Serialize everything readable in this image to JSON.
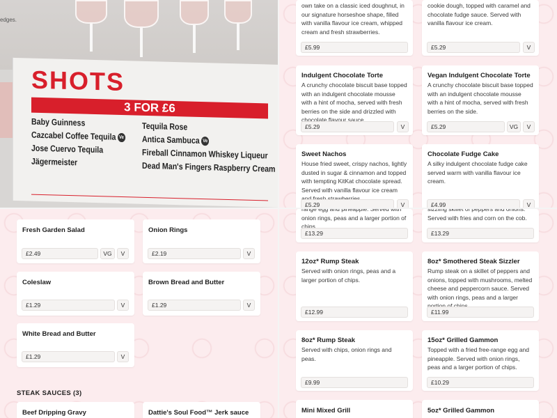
{
  "photo": {
    "edges_text": "edges.",
    "shots_title": "SHOTS",
    "shots_offer": "3 FOR £6",
    "left_items": [
      "Baby Guinness",
      "Cazcabel Coffee Tequila",
      "Jose Cuervo Tequila",
      "Jägermeister"
    ],
    "right_items": [
      "Tequila Rose",
      "Antica Sambuca",
      "Fireball Cinnamon Whiskey Liqueur",
      "Dead Man's Fingers Raspberry Cream"
    ],
    "vg_label": "Ve"
  },
  "top_right": {
    "card1": {
      "desc": "own take on a classic iced doughnut, in our signature horseshoe shape, filled with vanilla flavour ice cream, whipped cream and fresh strawberries.",
      "price": "£5.99"
    },
    "card2": {
      "desc": "cookie dough, topped with caramel and chocolate fudge sauce. Served with vanilla flavour ice cream.",
      "price": "£5.29",
      "tag1": "V"
    },
    "card3": {
      "title": "Indulgent Chocolate Torte",
      "desc": "A crunchy chocolate biscuit base topped with an indulgent chocolate mousse with a hint of mocha, served with fresh berries on the side and drizzled with chocolate flavour sauce.",
      "price": "£5.29",
      "tag1": "V"
    },
    "card4": {
      "title": "Vegan Indulgent Chocolate Torte",
      "desc": "A crunchy chocolate biscuit base topped with an indulgent chocolate mousse with a hint of mocha, served with fresh berries on the side.",
      "price": "£5.29",
      "tag1": "VG",
      "tag2": "V"
    },
    "card5": {
      "title": "Sweet Nachos",
      "desc": "House fried sweet, crispy nachos, lightly dusted in sugar & cinnamon and topped with tempting KitKat chocolate spread. Served with vanilla flavour ice cream and fresh strawberries.",
      "price": "£5.29",
      "tag1": "V"
    },
    "card6": {
      "title": "Chocolate Fudge Cake",
      "desc": "A silky indulgent chocolate fudge cake served warm with vanilla flavour ice cream.",
      "price": "£4.99",
      "tag1": "V"
    }
  },
  "bottom_left": {
    "card1": {
      "title": "Fresh Garden Salad",
      "price": "£2.49",
      "tag1": "VG",
      "tag2": "V"
    },
    "card2": {
      "title": "Onion Rings",
      "price": "£2.19",
      "tag1": "V"
    },
    "card3": {
      "title": "Coleslaw",
      "price": "£1.29",
      "tag1": "V"
    },
    "card4": {
      "title": "Brown Bread and Butter",
      "price": "£1.29",
      "tag1": "V"
    },
    "card5": {
      "title": "White Bread and Butter",
      "price": "£1.29",
      "tag1": "V"
    },
    "section_heading": "STEAK SAUCES (3)",
    "card6": {
      "title": "Beef Dripping Gravy"
    },
    "card7": {
      "title": "Dattie's Soul Food™ Jerk sauce"
    }
  },
  "bottom_right": {
    "card1": {
      "desc": "range egg and pineapple. Served with onion rings, peas and a larger portion of chips.",
      "price": "£13.29"
    },
    "card2": {
      "desc": "sizzling skillet of peppers and onions. Served with fries and corn on the cob.",
      "price": "£13.29"
    },
    "card3": {
      "title": "12oz* Rump Steak",
      "desc": "Served with onion rings, peas and a larger portion of chips.",
      "price": "£12.99"
    },
    "card4": {
      "title": "8oz* Smothered Steak Sizzler",
      "desc": "Rump steak on a skillet of peppers and onions, topped with mushrooms, melted cheese and peppercorn sauce. Served with onion rings, peas and a larger portion of chips.",
      "price": "£11.99"
    },
    "card5": {
      "title": "8oz* Rump Steak",
      "desc": "Served with chips, onion rings and peas.",
      "price": "£9.99"
    },
    "card6": {
      "title": "15oz* Grilled Gammon",
      "desc": "Topped with a fried free-range egg and pineapple. Served with onion rings, peas and a larger portion of chips.",
      "price": "£10.29"
    },
    "card7": {
      "title": "Mini Mixed Grill"
    },
    "card8": {
      "title": "5oz* Grilled Gammon"
    }
  }
}
